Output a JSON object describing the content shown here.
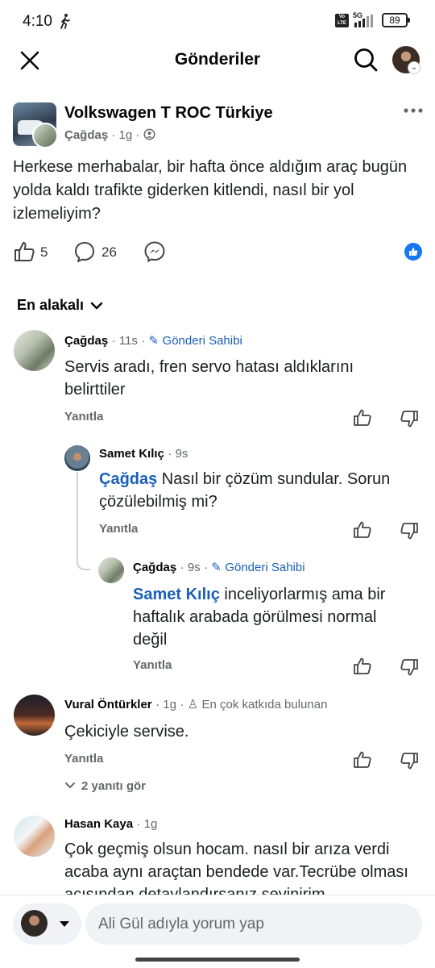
{
  "status": {
    "time": "4:10",
    "net": "5G",
    "volte": "Vo LTE",
    "battery": "89"
  },
  "header": {
    "title": "Gönderiler"
  },
  "post": {
    "group": "Volkswagen T ROC Türkiye",
    "author": "Çağdaş",
    "time": "1g",
    "text": "Herkese merhabalar, bir hafta önce aldığım araç bugün yolda kaldı trafikte giderken kitlendi, nasıl bir yol izlemeliyim?",
    "likes": "5",
    "comments": "26"
  },
  "sort": {
    "label": "En alakalı"
  },
  "comments": [
    {
      "author": "Çağdaş",
      "time": "11s",
      "tag": "Gönderi Sahibi",
      "text": "Servis aradı, fren servo hatası aldıklarını belirttiler",
      "reply": "Yanıtla",
      "replies": [
        {
          "author": "Samet Kılıç",
          "time": "9s",
          "mention": "Çağdaş",
          "text": " Nasıl bir çözüm sundular. Sorun çözülebilmiş mi?",
          "reply": "Yanıtla"
        },
        {
          "author": "Çağdaş",
          "time": "9s",
          "tag": "Gönderi Sahibi",
          "mention": "Samet Kılıç",
          "text": " inceliyorlarmış ama bir haftalık arabada görülmesi normal değil",
          "reply": "Yanıtla"
        }
      ]
    },
    {
      "author": "Vural Öntürkler",
      "time": "1g",
      "tag": "En çok katkıda bulunan",
      "text": "Çekiciyle servise.",
      "reply": "Yanıtla",
      "more_replies": "2 yanıtı gör"
    },
    {
      "author": "Hasan Kaya",
      "time": "1g",
      "text": "Çok geçmiş olsun hocam. nasıl bir arıza verdi acaba aynı araçtan bendede var.Tecrübe olması açısından detaylandırsanız sevinirim"
    }
  ],
  "composer": {
    "placeholder": "Ali Gül adıyla yorum yap"
  },
  "colors": {
    "accent": "#1877f2",
    "link": "#1b5fb8",
    "meta": "#65676b"
  }
}
